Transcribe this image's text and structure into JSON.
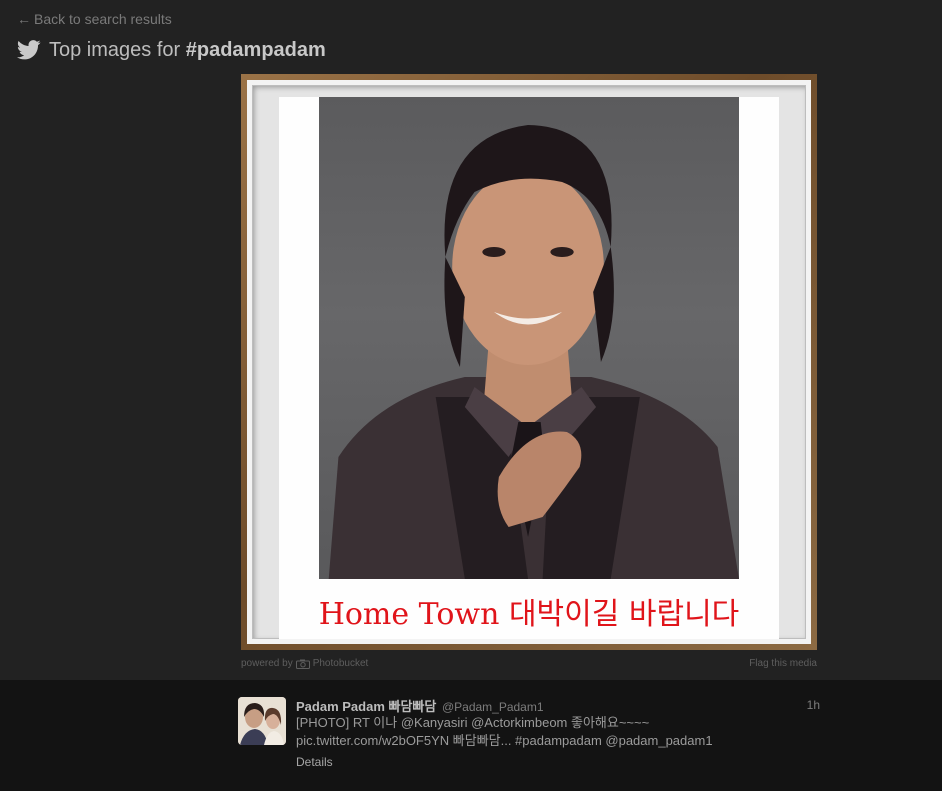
{
  "nav": {
    "back_arrow": "←",
    "back_label": "Back to search results"
  },
  "header": {
    "prefix": "Top images for ",
    "hashtag": "#padampadam"
  },
  "photo": {
    "caption": "Home Town 대박이길 바랍니다"
  },
  "footer": {
    "powered_by": "powered by",
    "provider": "Photobucket",
    "flag": "Flag this media"
  },
  "tweet": {
    "name": "Padam Padam 빠담빠담",
    "handle": "@Padam_Padam1",
    "time": "1h",
    "line1": "[PHOTO] RT 이나 @Kanyasiri @Actorkimbeom 좋아해요~~~~",
    "line2": "pic.twitter.com/w2bOF5YN 빠담빠담... #padampadam @padam_padam1",
    "details": "Details"
  },
  "icons": {
    "brand": "twitter-bird-icon",
    "camera": "camera-icon"
  },
  "colors": {
    "background": "#222222",
    "tweet_bg": "#131313",
    "caption": "#e0141a"
  }
}
